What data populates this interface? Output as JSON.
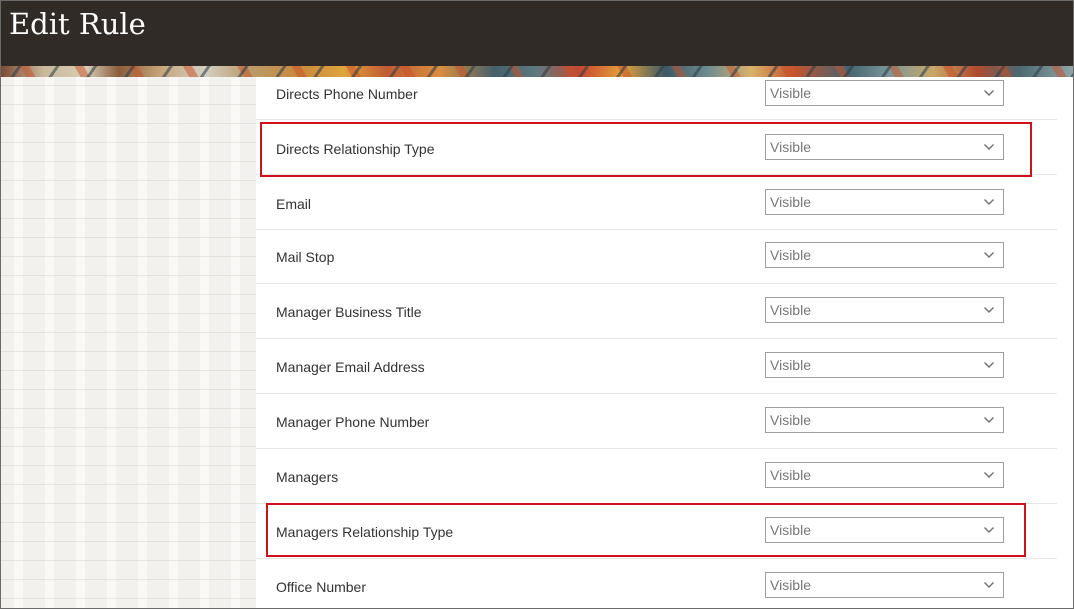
{
  "header": {
    "title": "Edit Rule"
  },
  "colors": {
    "header_bg": "#302b27",
    "highlight_border": "#d0111b",
    "row_divider": "#e6e6e6",
    "select_border": "#9e9e9e"
  },
  "rows": [
    {
      "label": "Directs Phone Number",
      "value": "Visible",
      "highlighted": false
    },
    {
      "label": "Directs Relationship Type",
      "value": "Visible",
      "highlighted": true
    },
    {
      "label": "Email",
      "value": "Visible",
      "highlighted": false
    },
    {
      "label": "Mail Stop",
      "value": "Visible",
      "highlighted": false
    },
    {
      "label": "Manager Business Title",
      "value": "Visible",
      "highlighted": false
    },
    {
      "label": "Manager Email Address",
      "value": "Visible",
      "highlighted": false
    },
    {
      "label": "Manager Phone Number",
      "value": "Visible",
      "highlighted": false
    },
    {
      "label": "Managers",
      "value": "Visible",
      "highlighted": false
    },
    {
      "label": "Managers Relationship Type",
      "value": "Visible",
      "highlighted": true
    },
    {
      "label": "Office Number",
      "value": "Visible",
      "highlighted": false
    }
  ],
  "icons": {
    "dropdown": "chevron-down-icon"
  }
}
